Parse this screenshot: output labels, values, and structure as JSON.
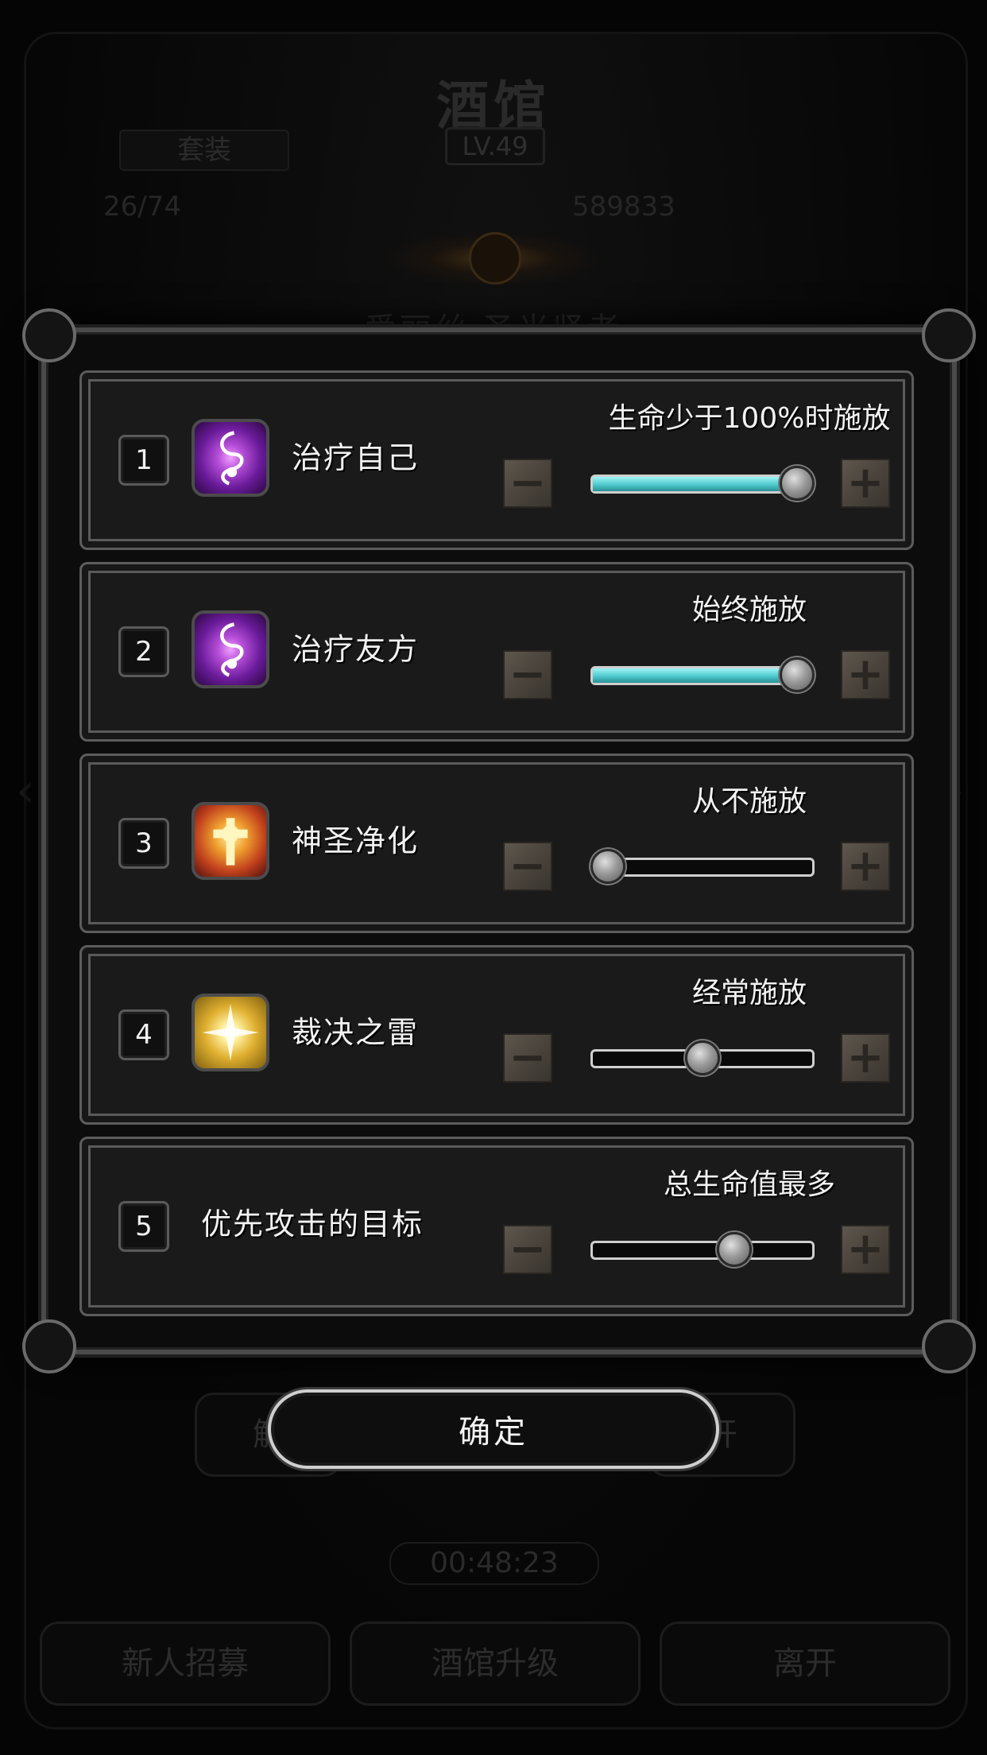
{
  "background": {
    "title": "酒馆",
    "level": "LV.49",
    "tab": "套装",
    "stat_left": "26/74",
    "stat_right": "589833",
    "hero_name": "爱丽丝 圣光贤者",
    "btn_left": "解",
    "btn_right": "开",
    "timer": "00:48:23",
    "bottom_buttons": [
      "新人招募",
      "酒馆升级",
      "离开"
    ]
  },
  "rows": [
    {
      "index": "1",
      "icon": "heal-icon",
      "label": "治疗自己",
      "status": "生命少于100%时施放",
      "value": 1.0,
      "filled": true
    },
    {
      "index": "2",
      "icon": "heal-icon",
      "label": "治疗友方",
      "status": "始终施放",
      "value": 1.0,
      "filled": true
    },
    {
      "index": "3",
      "icon": "holy-cross-icon",
      "label": "神圣净化",
      "status": "从不施放",
      "value": 0.0,
      "filled": false
    },
    {
      "index": "4",
      "icon": "thunder-icon",
      "label": "裁决之雷",
      "status": "经常施放",
      "value": 0.5,
      "filled": false
    },
    {
      "index": "5",
      "icon": "",
      "label": "优先攻击的目标",
      "status": "总生命值最多",
      "value": 0.67,
      "filled": false
    }
  ],
  "buttons": {
    "minus": "−",
    "plus": "+",
    "confirm": "确定"
  },
  "colors": {
    "slider_fill": "#4ec8cc",
    "panel": "#1a1a1a",
    "border": "#5c5c5c"
  }
}
